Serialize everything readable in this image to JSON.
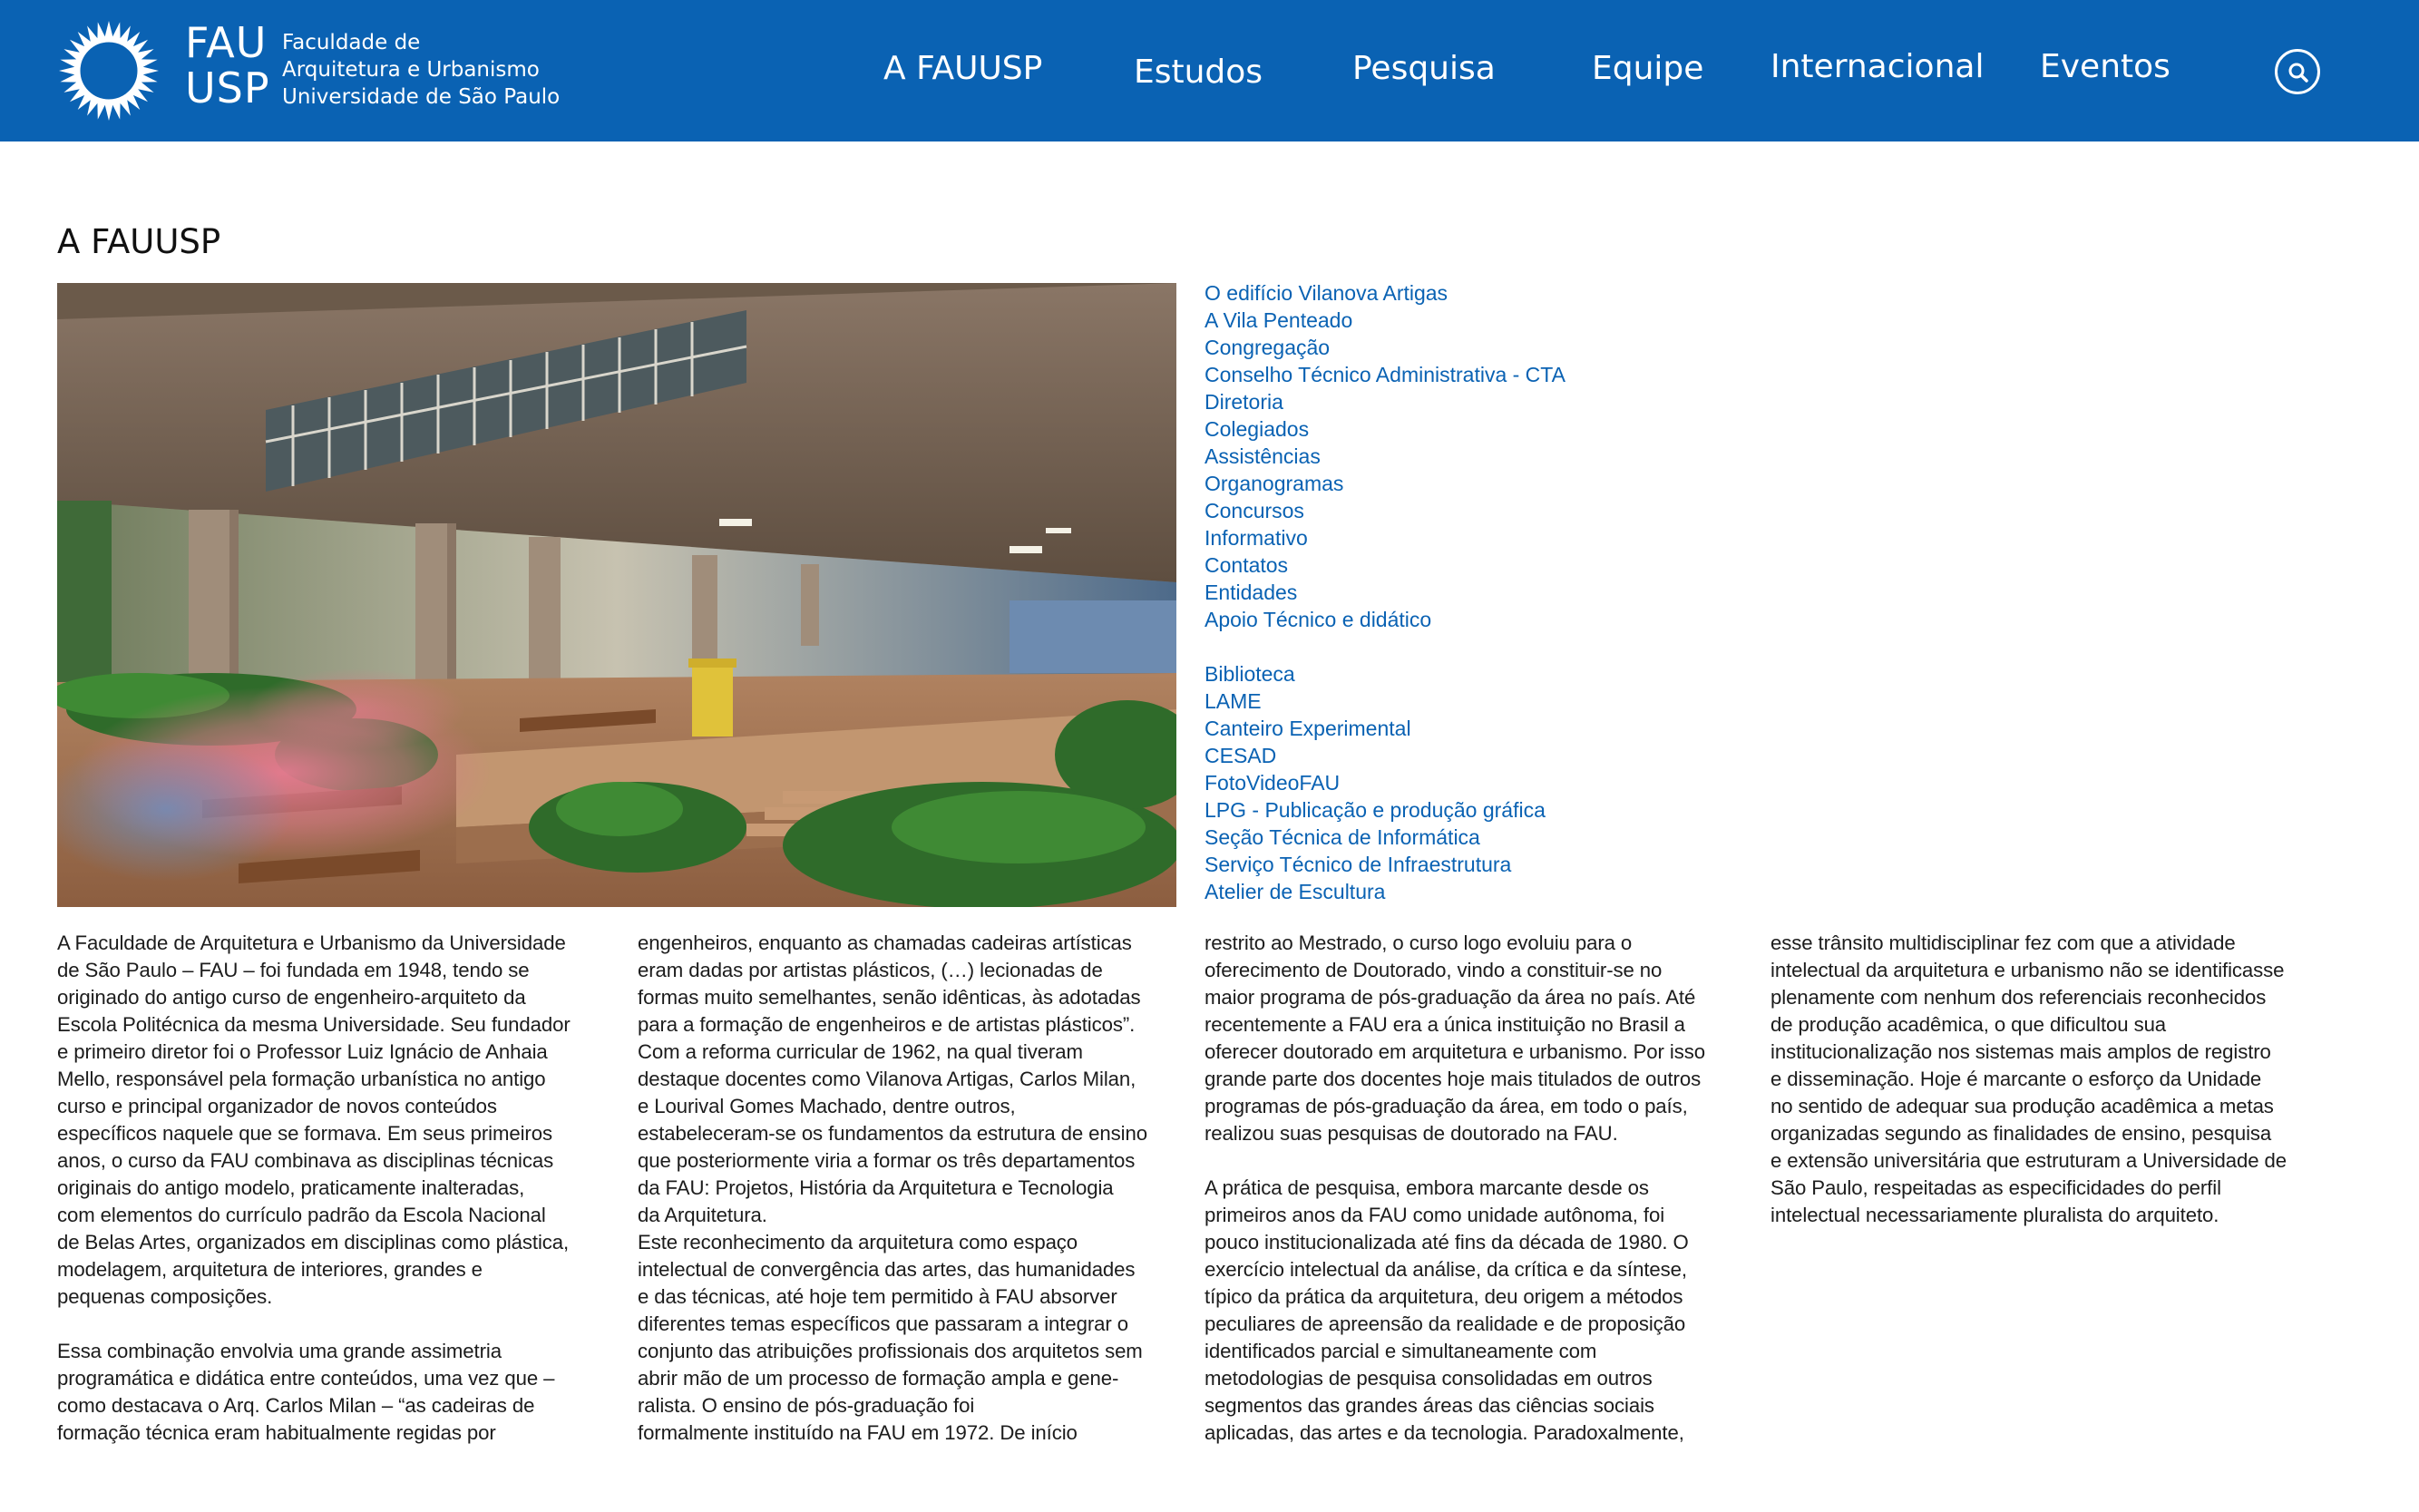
{
  "header": {
    "logo_fau_lines": [
      "FAU",
      "USP"
    ],
    "logo_text_lines": [
      "Faculdade de",
      "Arquitetura e Urbanismo",
      "Universidade de São Paulo"
    ],
    "nav": [
      "A FAUUSP",
      "Estudos",
      "Pesquisa",
      "Equipe",
      "Internacional",
      "Eventos"
    ],
    "search_icon": "search-icon"
  },
  "page": {
    "title": "A FAUUSP"
  },
  "side_links": {
    "group1": [
      "O edifício Vilanova Artigas",
      "A Vila Penteado",
      "Congregação",
      "Conselho Técnico Administrativa - CTA",
      "Diretoria",
      "Colegiados",
      "Assistências",
      "Organogramas",
      "Concursos",
      "Informativo",
      "Contatos",
      "Entidades",
      "Apoio Técnico e didático"
    ],
    "group2": [
      "Biblioteca",
      "LAME",
      "Canteiro Experimental",
      "CESAD",
      "FotoVideoFAU",
      "LPG - Publicação e produção gráfica",
      "Seção Técnica de Informática",
      "Serviço Técnico de Infraestrutura",
      "Atelier de Escultura"
    ]
  },
  "body": {
    "col1": [
      "A Faculdade de Arquitetura e Urbanismo da Universidade",
      "de São Paulo – FAU – foi fundada em 1948, tendo se",
      "originado do antigo curso de engenheiro-arquiteto da",
      "Escola Politécnica da mesma Universidade. Seu fundador",
      "e primeiro diretor foi o Professor Luiz Ignácio de Anhaia",
      "Mello, responsável pela formação urbanística no antigo",
      "curso e principal organizador de novos conteúdos",
      "específicos naquele que se formava. Em seus primeiros",
      "anos, o curso da FAU combinava as disciplinas técnicas",
      "originais do antigo modelo, praticamente inalteradas,",
      "com elementos do currículo padrão da Escola Nacional",
      "de Belas Artes, organizados em disciplinas como plástica,",
      "modelagem, arquitetura de interiores, grandes e",
      "pequenas composições.",
      "",
      "Essa combinação envolvia uma grande assimetria",
      "programática e didática entre conteúdos, uma vez que –",
      "como destacava o Arq. Carlos Milan – “as cadeiras de",
      "formação técnica eram habitualmente regidas por"
    ],
    "col2": [
      "engenheiros, enquanto as chamadas cadeiras artísticas",
      "eram dadas por artistas plásticos, (…) lecionadas de",
      "formas muito semelhantes, senão idênticas, às adotadas",
      "para a formação de engenheiros e de artistas plásticos”.",
      "Com a reforma curricular de 1962, na qual tiveram",
      "destaque docentes como Vilanova Artigas, Carlos Milan,",
      "e Lourival Gomes Machado, dentre outros,",
      "estabeleceram-se os fundamentos da estrutura de ensino",
      "que posteriormente viria a formar os três departamentos",
      "da FAU: Projetos, História da Arquitetura e Tecnologia",
      "da Arquitetura.",
      "Este reconhecimento da arquitetura como espaço",
      "intelectual de convergência das artes, das humanidades",
      "e das técnicas, até hoje tem permitido à FAU absorver",
      "diferentes temas específicos que passaram a integrar o",
      "conjunto das atribuições profissionais dos arquitetos sem",
      "abrir mão de um processo de formação ampla e gene-",
      "ralista. O ensino de pós-graduação foi",
      "formalmente instituído na FAU em 1972. De início"
    ],
    "col3": [
      "restrito ao Mestrado, o curso logo evoluiu para o",
      "oferecimento de Doutorado, vindo a constituir-se no",
      "maior programa de pós-graduação da área no país. Até",
      "recentemente a FAU era a única instituição no Brasil a",
      "oferecer doutorado em arquitetura e urbanismo. Por isso",
      "grande parte dos docentes hoje mais titulados de outros",
      "programas de pós-graduação da área, em todo o país,",
      "realizou suas pesquisas de doutorado na FAU.",
      "",
      "A prática de pesquisa, embora marcante desde os",
      "primeiros anos da FAU como unidade autônoma, foi",
      "pouco institucionalizada até fins da década de 1980. O",
      "exercício intelectual da análise, da crítica e da síntese,",
      "típico da prática da arquitetura, deu origem a métodos",
      "peculiares de apreensão da realidade e de proposição",
      "identificados parcial e simultaneamente com",
      "metodologias de pesquisa consolidadas em outros",
      "segmentos das grandes áreas das ciências sociais",
      "aplicadas, das artes e da tecnologia. Paradoxalmente,"
    ],
    "col4": [
      "esse trânsito multidisciplinar fez com que a atividade",
      "intelectual da arquitetura e urbanismo não se identificasse",
      "plenamente com nenhum dos referenciais reconhecidos",
      "de produção acadêmica, o que dificultou sua",
      "institucionalização nos sistemas mais amplos de registro",
      "e disseminação. Hoje é marcante o esforço da Unidade",
      "no sentido de adequar sua produção acadêmica a metas",
      "organizadas segundo as finalidades de ensino, pesquisa",
      "e extensão universitária que estruturam a Universidade de",
      "São Paulo, respeitadas as especificidades do perfil",
      "intelectual necessariamente pluralista do arquiteto."
    ]
  },
  "colors": {
    "brand_blue": "#0a62b3",
    "link_blue": "#0a62b3",
    "text": "#1c1c1c"
  }
}
